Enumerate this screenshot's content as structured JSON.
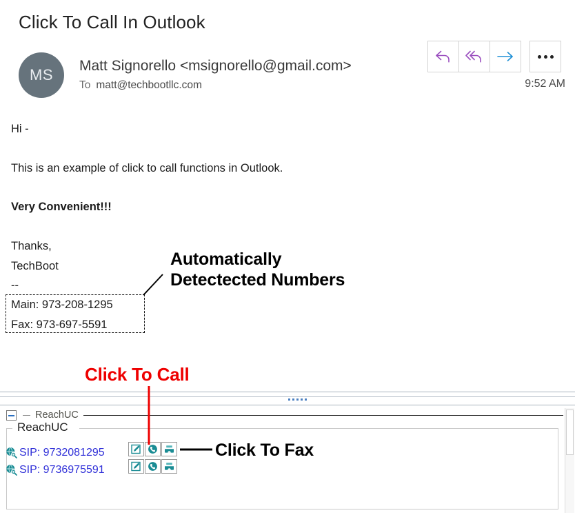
{
  "email": {
    "subject": "Click To Call In Outlook",
    "avatar_initials": "MS",
    "sender": "Matt Signorello <msignorello@gmail.com>",
    "to_label": "To",
    "to_address": "matt@techbootllc.com",
    "timestamp": "9:52 AM",
    "body": {
      "greeting": "Hi -",
      "paragraph": "This is an example of click to call functions in Outlook.",
      "emphasis": "Very Convenient!!!",
      "sign_off": "Thanks,",
      "company": "TechBoot",
      "separator": "--",
      "phone_main": "Main: 973-208-1295",
      "phone_fax": "Fax: 973-697-5591"
    },
    "actions": [
      {
        "name": "reply",
        "label": "Reply",
        "color": "#9B4FBF"
      },
      {
        "name": "reply-all",
        "label": "Reply all",
        "color": "#9B4FBF"
      },
      {
        "name": "forward",
        "label": "Forward",
        "color": "#1E8FD5"
      },
      {
        "name": "more",
        "label": "More actions",
        "color": "#222222"
      }
    ]
  },
  "annotations": {
    "detected_numbers_line1": "Automatically",
    "detected_numbers_line2": "Detectected Numbers",
    "click_to_call": "Click To Call",
    "click_to_fax": "Click To Fax",
    "click_to_call_color": "#EE0000",
    "click_to_fax_color": "#000000"
  },
  "addin": {
    "panel_title": "ReachUC",
    "group_label": "ReachUC",
    "rows": [
      {
        "label": "SIP: 9732081295",
        "buttons": [
          {
            "name": "compose-sms-button",
            "title": "Send message"
          },
          {
            "name": "call-button",
            "title": "Call"
          },
          {
            "name": "fax-button",
            "title": "Fax"
          }
        ]
      },
      {
        "label": "SIP: 9736975591",
        "buttons": [
          {
            "name": "compose-sms-button",
            "title": "Send message"
          },
          {
            "name": "call-button",
            "title": "Call"
          },
          {
            "name": "fax-button",
            "title": "Fax"
          }
        ]
      }
    ],
    "link_color": "#2F2FD8",
    "icon_color": "#1A8C94"
  }
}
